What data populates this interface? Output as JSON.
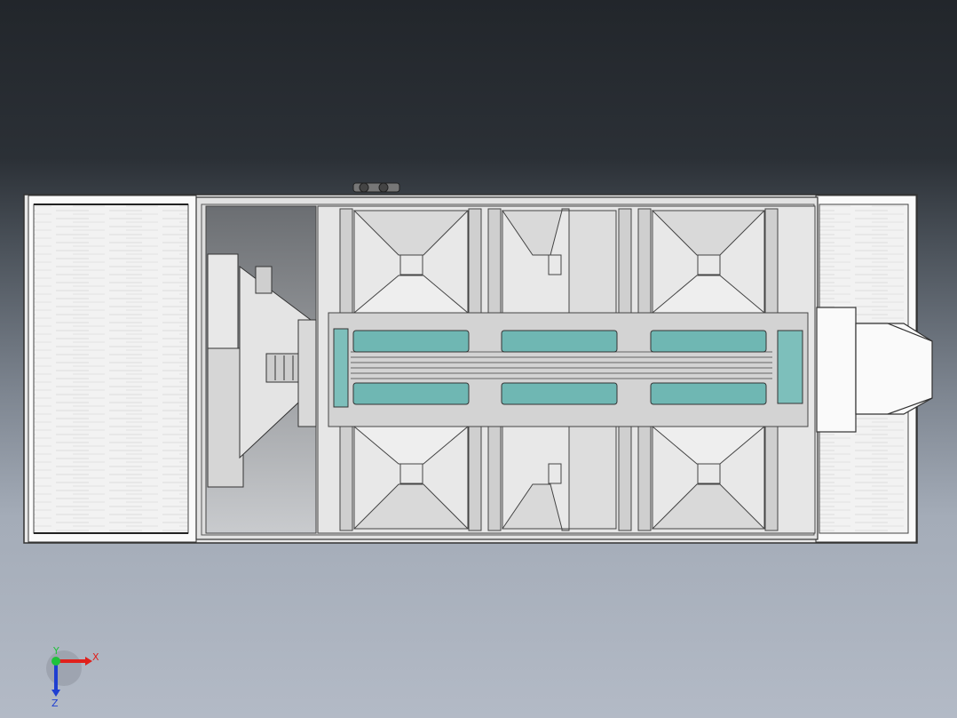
{
  "viewport": {
    "background_top": "#22262b",
    "background_bottom": "#b3bac6"
  },
  "model": {
    "frame_color": "#d8d8d8",
    "belt_color": "#6fb7b3",
    "panel_color": "#e6e6e6",
    "cover_color": "#f3f3f3"
  },
  "triad": {
    "x_label": "X",
    "y_label": "Y",
    "z_label": "Z",
    "x_color": "#e0201b",
    "y_color": "#1fc23a",
    "z_color": "#1f3fd1"
  }
}
